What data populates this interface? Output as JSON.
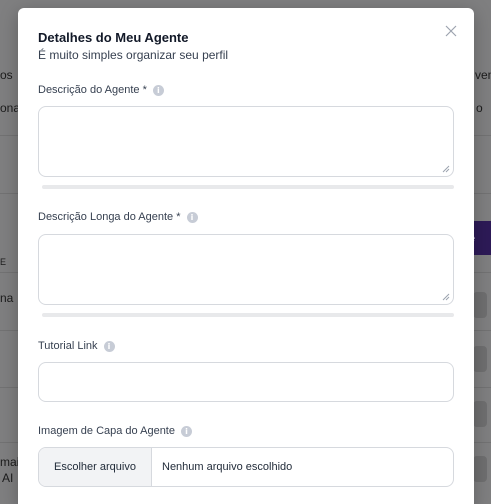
{
  "background": {
    "fragments": [
      {
        "text": "os",
        "side": "left"
      },
      {
        "text": "ona",
        "side": "left"
      },
      {
        "text": "E",
        "side": "left"
      },
      {
        "text": "na",
        "side": "left"
      },
      {
        "text": "mai",
        "side": "left"
      },
      {
        "text": "AI",
        "side": "left"
      },
      {
        "text": "ven",
        "side": "right"
      },
      {
        "text": "o",
        "side": "right"
      }
    ],
    "dark_button_label": "te"
  },
  "modal": {
    "title": "Detalhes do Meu Agente",
    "subtitle": "É muito simples organizar seu perfil",
    "close_icon": "close-icon"
  },
  "form": {
    "description": {
      "label": "Descrição do Agente *",
      "value": ""
    },
    "long_description": {
      "label": "Descrição Longa do Agente *",
      "value": ""
    },
    "tutorial_link": {
      "label": "Tutorial Link",
      "value": ""
    },
    "cover_image": {
      "label": "Imagem de Capa do Agente",
      "button_label": "Escolher arquivo",
      "status": "Nenhum arquivo escolhido"
    }
  },
  "colors": {
    "overlay": "#7f7f80",
    "accent_dark": "#2d1a57",
    "border": "#d6d9de",
    "info_icon": "#c7ccd6"
  }
}
